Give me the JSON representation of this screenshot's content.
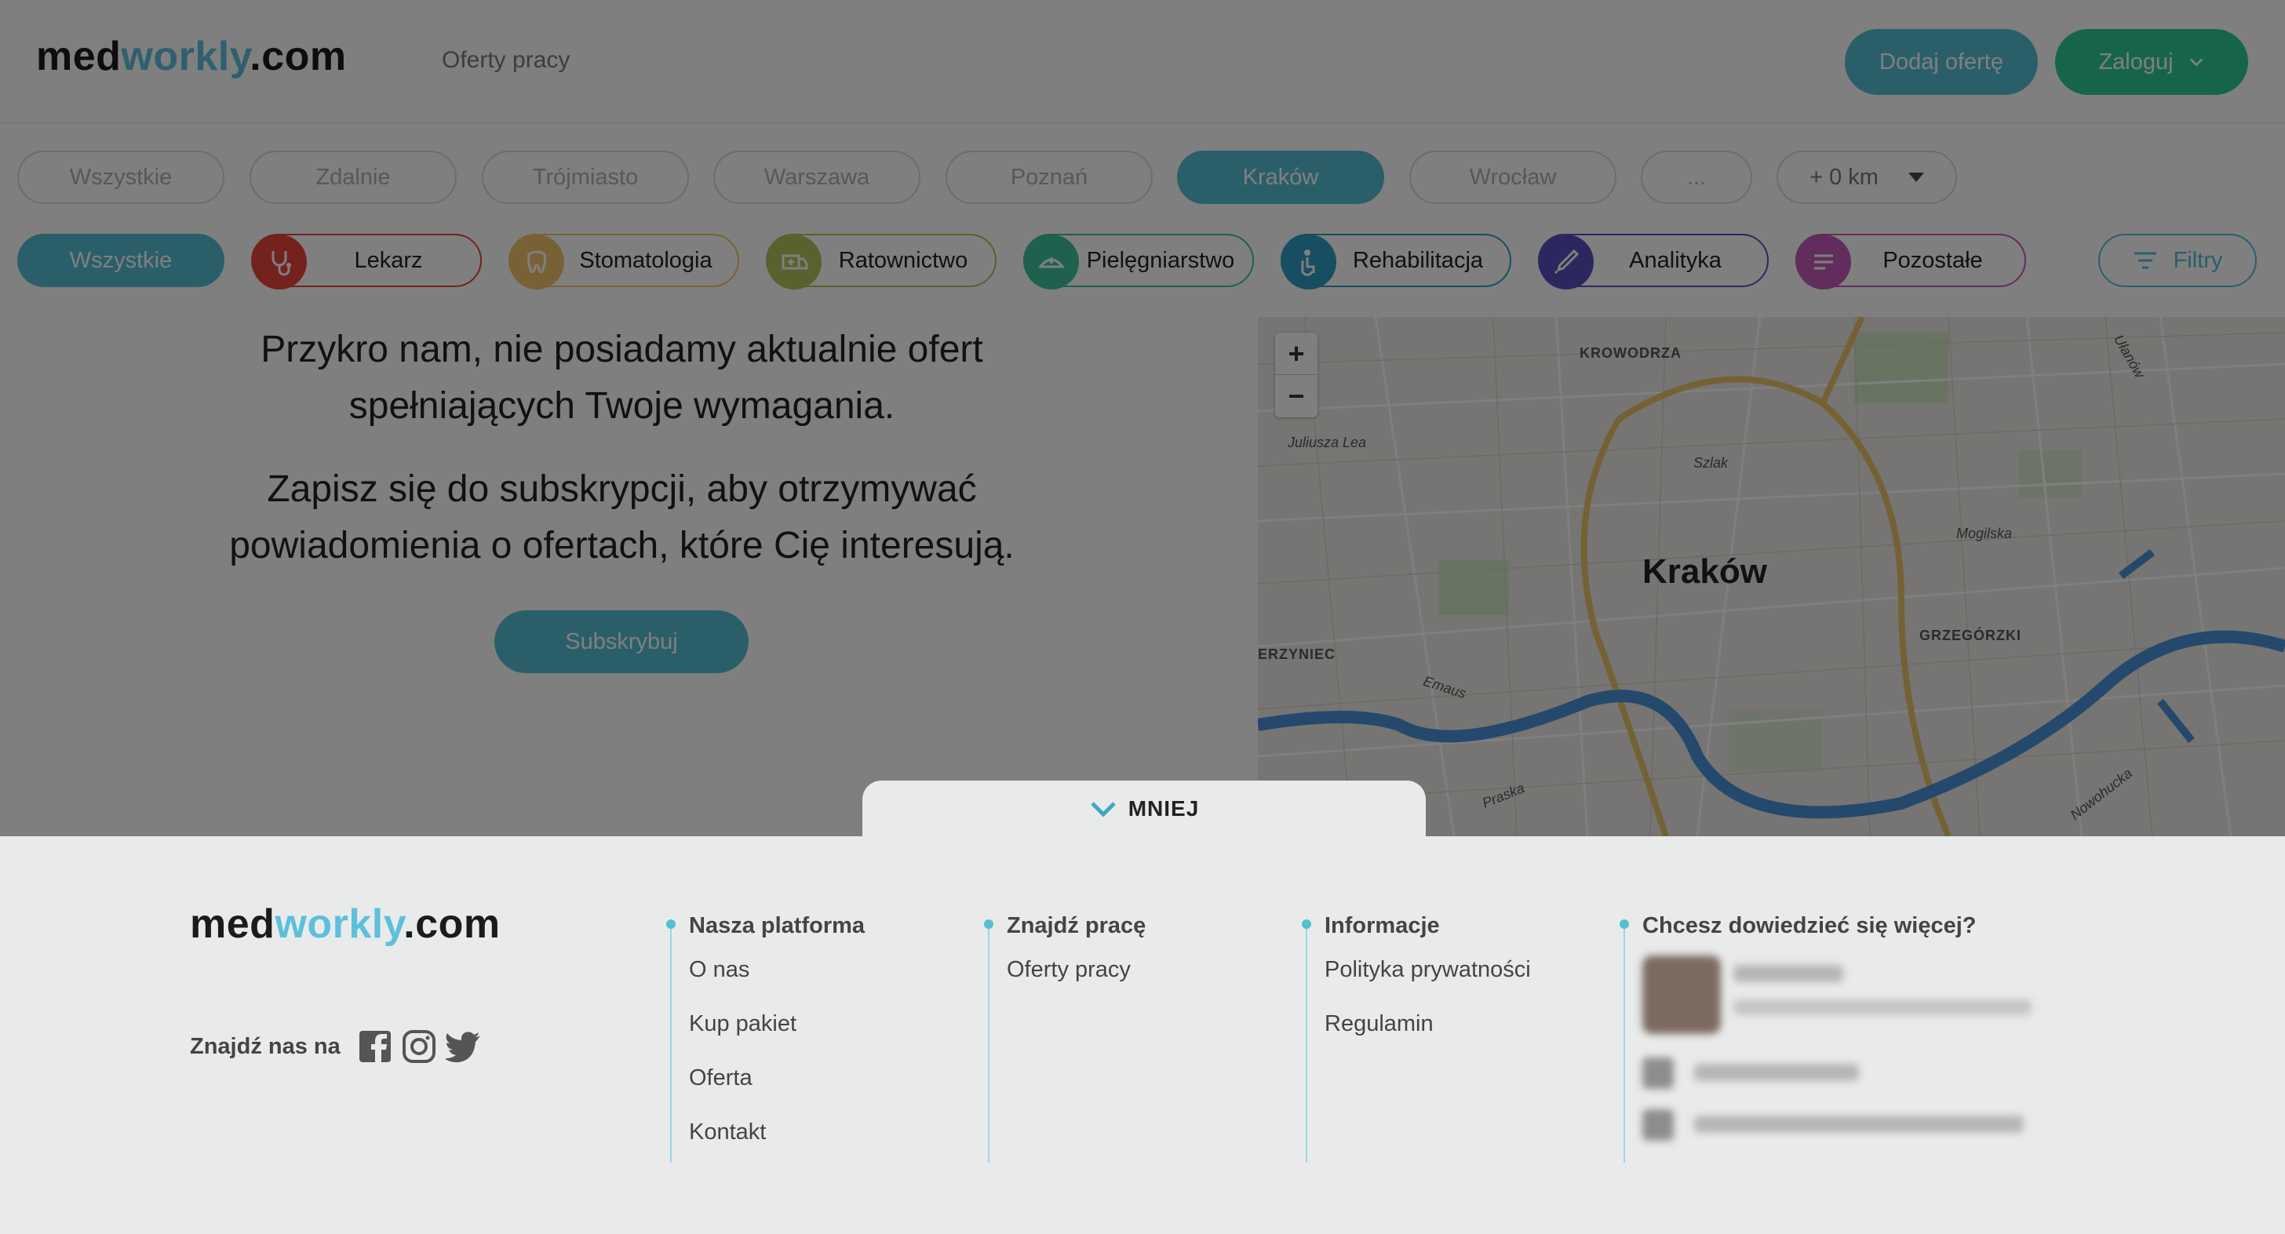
{
  "header": {
    "logo": {
      "part1": "med",
      "part2": "workly",
      "part3": ".com"
    },
    "nav_link": "Oferty pracy",
    "add_offer": "Dodaj ofertę",
    "login": "Zaloguj"
  },
  "locations": {
    "items": [
      "Wszystkie",
      "Zdalnie",
      "Trójmiasto",
      "Warszawa",
      "Poznań",
      "Kraków",
      "Wrocław",
      "..."
    ],
    "active": "Kraków",
    "radius": "+ 0 km"
  },
  "categories": {
    "all": "Wszystkie",
    "items": [
      {
        "label": "Lekarz",
        "icon": "stethoscope-icon",
        "color": "#e8453c"
      },
      {
        "label": "Stomatologia",
        "icon": "tooth-icon",
        "color": "#f1c46b"
      },
      {
        "label": "Ratownictwo",
        "icon": "ambulance-icon",
        "color": "#b5c25a"
      },
      {
        "label": "Pielęgniarstwo",
        "icon": "nurse-cap-icon",
        "color": "#3fc39d"
      },
      {
        "label": "Rehabilitacja",
        "icon": "rehabilitation-icon",
        "color": "#2f9cc2"
      },
      {
        "label": "Analityka",
        "icon": "pipette-icon",
        "color": "#5b4fc0"
      },
      {
        "label": "Pozostałe",
        "icon": "list-icon",
        "color": "#c45ab8"
      }
    ],
    "filters": "Filtry"
  },
  "empty_state": {
    "line1": "Przykro nam, nie posiadamy aktualnie ofert",
    "line2": "spełniających Twoje wymagania.",
    "line3": "Zapisz się do subskrypcji, aby otrzymywać",
    "line4": "powiadomienia o ofertach, które Cię interesują.",
    "subscribe": "Subskrybuj"
  },
  "map": {
    "city": "Kraków",
    "labels": [
      "KROWODRZA",
      "Juliusza Lea",
      "Szlak",
      "Mogilska",
      "GRZEGÓRZKI",
      "ERZYNIEC",
      "Emaus",
      "Praska",
      "Nowohucka",
      "Ułanów"
    ],
    "zoom_in": "+",
    "zoom_out": "−"
  },
  "footer": {
    "toggle": "MNIEJ",
    "logo": {
      "part1": "med",
      "part2": "workly",
      "part3": ".com"
    },
    "find_us": "Znajdź nas na",
    "platform": {
      "title": "Nasza platforma",
      "items": [
        "O nas",
        "Kup pakiet",
        "Oferta",
        "Kontakt"
      ]
    },
    "jobs": {
      "title": "Znajdź pracę",
      "items": [
        "Oferty pracy"
      ]
    },
    "info": {
      "title": "Informacje",
      "items": [
        "Polityka prywatności",
        "Regulamin"
      ]
    },
    "contact": {
      "title": "Chcesz dowiedzieć się więcej?"
    }
  },
  "colors": {
    "brand": "#55bfd4",
    "login": "#2ec99a",
    "footer_bg": "#e9ebea"
  }
}
